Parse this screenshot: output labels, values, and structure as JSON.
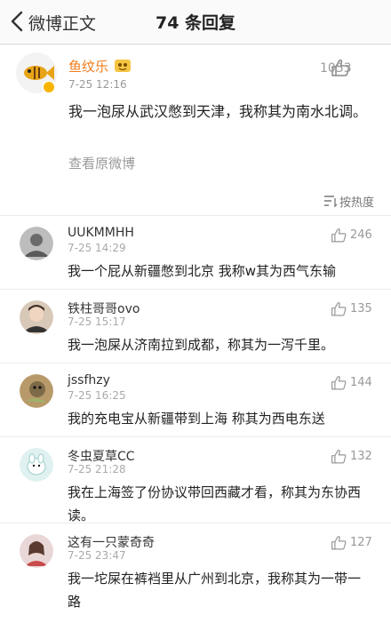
{
  "nav": {
    "back_label": "微博正文",
    "title": "74 条回复"
  },
  "post": {
    "author": "鱼纹乐",
    "time": "7-25 12:16",
    "likes": "1053",
    "text": "我一泡尿从武汉憋到天津，我称其为南水北调。",
    "view_original": "查看原微博"
  },
  "sort": {
    "label": "按热度",
    "icon": "sort-lines-icon"
  },
  "comments": [
    {
      "name": "UUKMMHH",
      "time": "7-25 14:29",
      "likes": "246",
      "text": "我一个屁从新疆憋到北京 我称w其为西气东输"
    },
    {
      "name": "铁柱哥哥ovo",
      "time": "7-25 15:17",
      "likes": "135",
      "text": "我一泡屎从济南拉到成都，称其为一泻千里。"
    },
    {
      "name": "jssfhzy",
      "time": "7-25 16:25",
      "likes": "144",
      "text": "我的充电宝从新疆带到上海 称其为西电东送"
    },
    {
      "name": "冬虫夏草CC",
      "time": "7-25 21:28",
      "likes": "132",
      "text": "我在上海签了份协议带回西藏才看，称其为东协西读。"
    },
    {
      "name": "这有一只蒙奇奇",
      "time": "7-25 23:47",
      "likes": "127",
      "text": "我一坨屎在裤裆里从广州到北京，我称其为一带一路"
    }
  ],
  "colors": {
    "author_name": "#ef7c1c",
    "verified_badge": "#f7b500",
    "muted_text": "#999999"
  }
}
